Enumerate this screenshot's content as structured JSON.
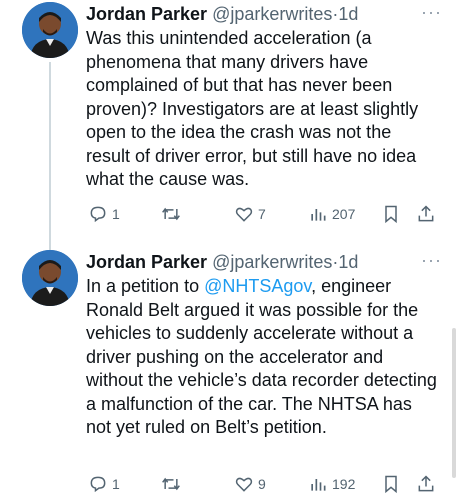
{
  "tweets": [
    {
      "author": {
        "name": "Jordan Parker",
        "handle": "@jparkerwrites",
        "separator": "·",
        "time": "1d"
      },
      "more_label": "···",
      "text": "Was this unintended acceleration (a phenomena that many drivers have complained of but that has never been proven)? Investigators are at least slightly open to the idea the crash was not the result of driver error, but still have no idea what the cause was.",
      "stats": {
        "replies": "1",
        "retweets": "",
        "likes": "7",
        "views": "207"
      }
    },
    {
      "author": {
        "name": "Jordan Parker",
        "handle": "@jparkerwrites",
        "separator": "·",
        "time": "1d"
      },
      "more_label": "···",
      "text_before": "In a petition to ",
      "mention": "@NHTSAgov",
      "text_after": ", engineer Ronald Belt argued it was possible for the vehicles to suddenly accelerate without a driver pushing on the accelerator and without the vehicle’s data recorder detecting a malfunction of the car. The NHTSA has not yet ruled on Belt’s petition.",
      "stats": {
        "replies": "1",
        "retweets": "",
        "likes": "9",
        "views": "192"
      }
    }
  ],
  "colors": {
    "text": "#0f1419",
    "secondary": "#536471",
    "link": "#1d9bf0",
    "thread_line": "#cfd9de"
  },
  "icons": [
    "avatar",
    "more-icon",
    "reply-icon",
    "retweet-icon",
    "like-icon",
    "views-icon",
    "bookmark-icon",
    "share-icon"
  ]
}
